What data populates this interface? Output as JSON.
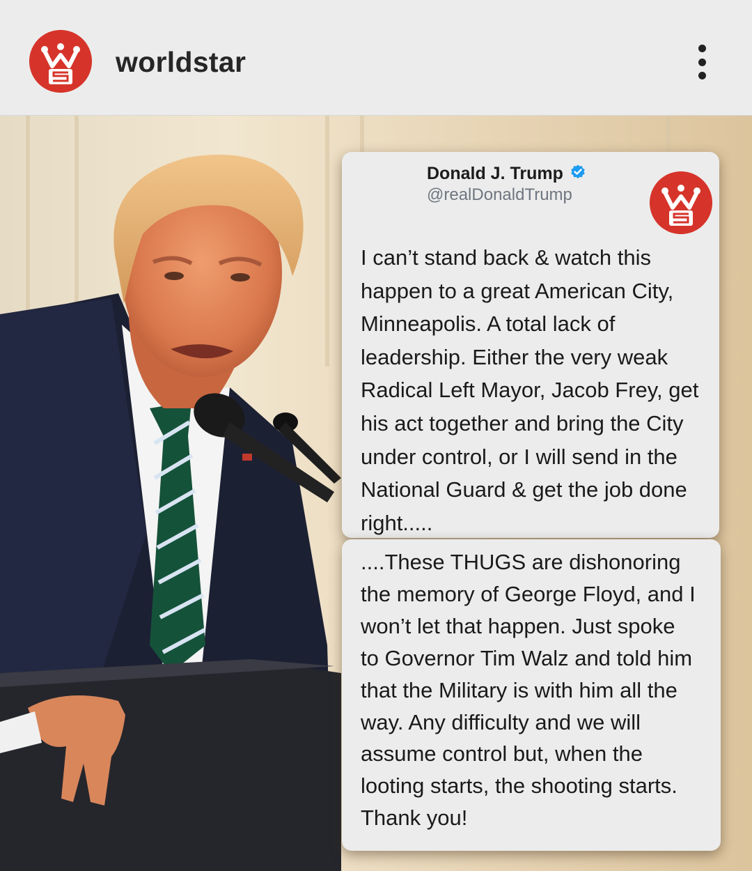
{
  "header": {
    "account_name": "worldstar",
    "avatar_icon": "worldstar-logo",
    "menu_icon": "more-vertical-icon"
  },
  "post": {
    "tweet": {
      "author_name": "Donald J. Trump",
      "author_handle": "@realDonaldTrump",
      "verified_icon": "verified-badge-icon",
      "text_part_1": "I can’t stand back & watch this\nhappen to a great American City,\nMinneapolis. A total lack of\nleadership. Either the very weak\nRadical Left Mayor, Jacob Frey, get\nhis act together and bring the City\nunder control, or I will send in the\nNational Guard & get the job done\nright.....",
      "text_part_2": "....These THUGS are dishonoring\nthe memory of George Floyd, and I\nwon’t let that happen. Just spoke\nto Governor Tim Walz and told him\nthat the Military is with him all the\nway. Any difficulty and we will\nassume control but, when the\nlooting starts, the shooting starts.\nThank you!"
    }
  },
  "colors": {
    "brand_red": "#d6342a",
    "verified_blue": "#1d9bf0",
    "card_background": "#ececec"
  }
}
